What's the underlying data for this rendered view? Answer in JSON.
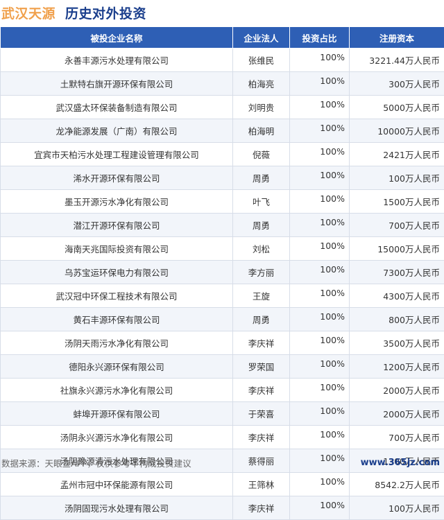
{
  "header": {
    "company": "武汉天源",
    "subtitle": "历史对外投资"
  },
  "table": {
    "columns": [
      "被投企业名称",
      "企业法人",
      "投资占比",
      "注册资本"
    ],
    "rows": [
      {
        "name": "永善丰源污水处理有限公司",
        "person": "张维民",
        "ratio": "100%",
        "capital": "3221.44万人民币"
      },
      {
        "name": "土默特右旗开源环保有限公司",
        "person": "柏海亮",
        "ratio": "100%",
        "capital": "300万人民币"
      },
      {
        "name": "武汉盛太环保装备制造有限公司",
        "person": "刘明贵",
        "ratio": "100%",
        "capital": "5000万人民币"
      },
      {
        "name": "龙净能源发展（广南）有限公司",
        "person": "柏海明",
        "ratio": "100%",
        "capital": "10000万人民币"
      },
      {
        "name": "宜宾市天柏污水处理工程建设管理有限公司",
        "person": "倪薇",
        "ratio": "100%",
        "capital": "2421万人民币"
      },
      {
        "name": "浠水开源环保有限公司",
        "person": "周勇",
        "ratio": "100%",
        "capital": "100万人民币"
      },
      {
        "name": "墨玉开源污水净化有限公司",
        "person": "叶飞",
        "ratio": "100%",
        "capital": "1500万人民币"
      },
      {
        "name": "潜江开源环保有限公司",
        "person": "周勇",
        "ratio": "100%",
        "capital": "700万人民币"
      },
      {
        "name": "海南天兆国际投资有限公司",
        "person": "刘松",
        "ratio": "100%",
        "capital": "15000万人民币"
      },
      {
        "name": "乌苏宝运环保电力有限公司",
        "person": "李方丽",
        "ratio": "100%",
        "capital": "7300万人民币"
      },
      {
        "name": "武汉冠中环保工程技术有限公司",
        "person": "王旋",
        "ratio": "100%",
        "capital": "4300万人民币"
      },
      {
        "name": "黄石丰源环保有限公司",
        "person": "周勇",
        "ratio": "100%",
        "capital": "800万人民币"
      },
      {
        "name": "汤阴天雨污水净化有限公司",
        "person": "李庆祥",
        "ratio": "100%",
        "capital": "3500万人民币"
      },
      {
        "name": "德阳永兴源环保有限公司",
        "person": "罗荣国",
        "ratio": "100%",
        "capital": "1200万人民币"
      },
      {
        "name": "社旗永兴源污水净化有限公司",
        "person": "李庆祥",
        "ratio": "100%",
        "capital": "2000万人民币"
      },
      {
        "name": "蚌埠开源环保有限公司",
        "person": "于荣喜",
        "ratio": "100%",
        "capital": "2000万人民币"
      },
      {
        "name": "汤阴永兴源污水净化有限公司",
        "person": "李庆祥",
        "ratio": "100%",
        "capital": "700万人民币"
      },
      {
        "name": "汤阴豫源清污水处理有限公司",
        "person": "蔡得丽",
        "ratio": "100%",
        "capital": "1300万人民币"
      },
      {
        "name": "孟州市冠中环保能源有限公司",
        "person": "王筛林",
        "ratio": "100%",
        "capital": "8542.2万人民币"
      },
      {
        "name": "汤阴固现污水处理有限公司",
        "person": "李庆祥",
        "ratio": "100%",
        "capital": "100万人民币"
      }
    ]
  },
  "footer": {
    "source": "数据来源：天眼查APP，仅供参考不构成投资建议",
    "site": "www.365jz.com"
  },
  "colors": {
    "header_bg": "#2e5fb5",
    "title_orange": "#f0a04b",
    "title_blue": "#1a3e8c",
    "row_alt": "#f2f5fa"
  }
}
